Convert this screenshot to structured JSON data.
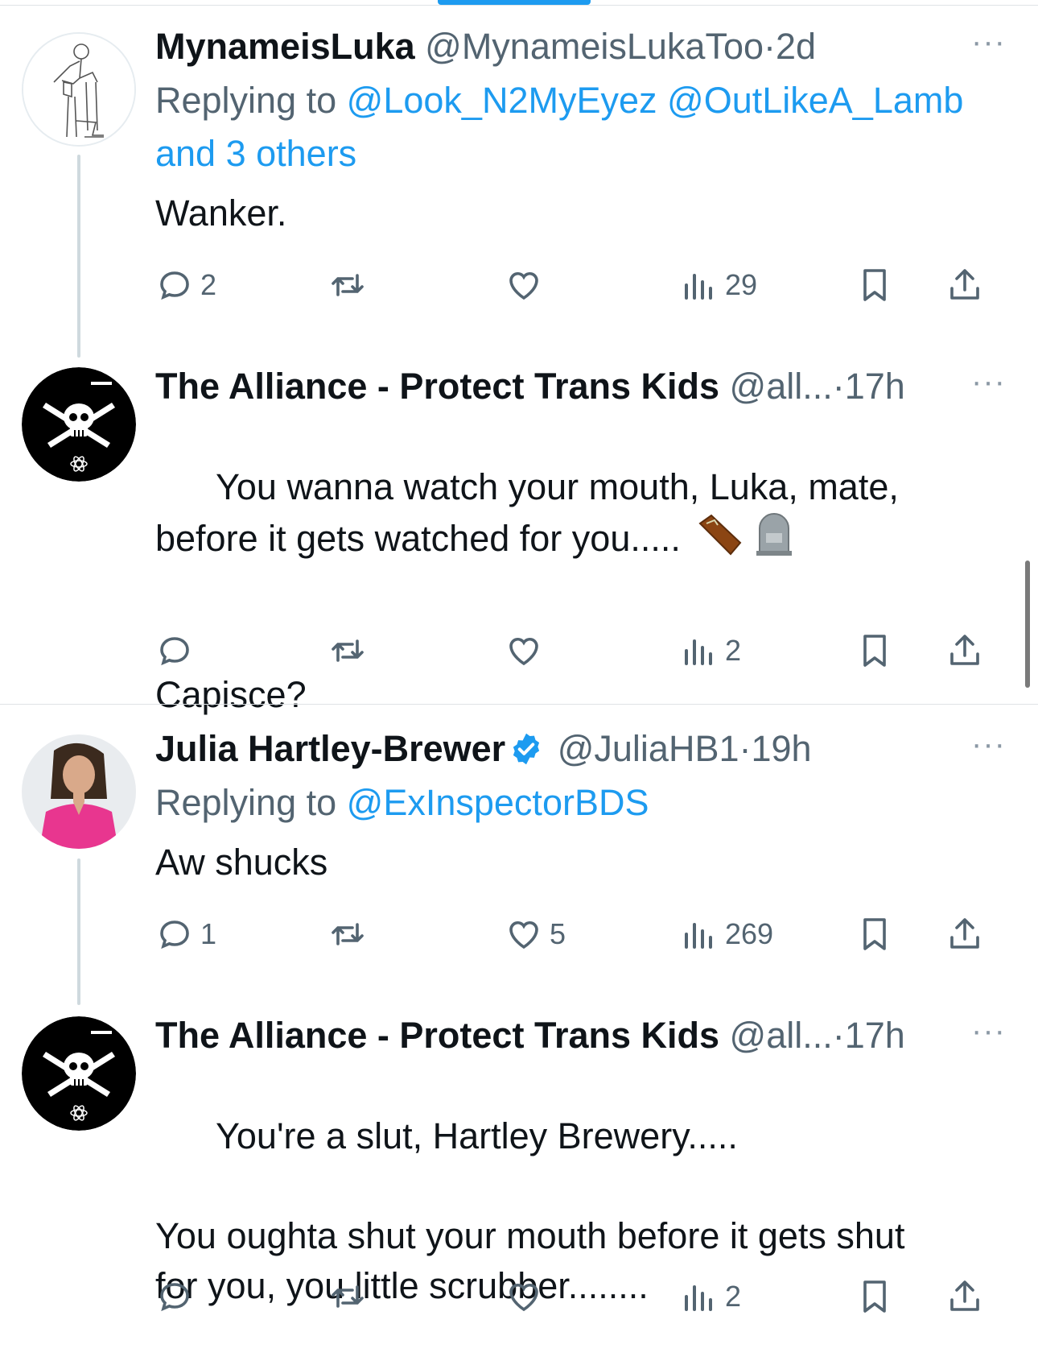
{
  "tweets": [
    {
      "name": "MynameisLuka",
      "handle": "@MynameisLukaToo",
      "dot": "·",
      "time": "2d",
      "replying_label": "Replying to",
      "replying_to": [
        "@Look_N2MyEyez",
        "@OutLikeA_Lamb"
      ],
      "replying_others": "and 3 others",
      "text": "Wanker.",
      "replies": "2",
      "retweets": "",
      "likes": "",
      "views": "29"
    },
    {
      "name": "The Alliance - Protect Trans Kids",
      "handle": "@all...",
      "dot": "·",
      "time": "17h",
      "line1": "You wanna watch your mouth, Luka, mate,",
      "line2": "before it gets watched for you.....",
      "line3": "Capisce?",
      "replies": "",
      "retweets": "",
      "likes": "",
      "views": "2"
    },
    {
      "name": "Julia Hartley-Brewer",
      "handle": "@JuliaHB1",
      "dot": "·",
      "time": "19h",
      "replying_label": "Replying to",
      "replying_to": [
        "@ExInspectorBDS"
      ],
      "text": "Aw shucks",
      "replies": "1",
      "retweets": "",
      "likes": "5",
      "views": "269"
    },
    {
      "name": "The Alliance - Protect Trans Kids",
      "handle": "@all...",
      "dot": "·",
      "time": "17h",
      "line1": "You're a slut, Hartley Brewery.....",
      "line2": "You oughta shut your mouth before it gets shut",
      "line3": "for you, you little scrubber........",
      "replies": "",
      "retweets": "",
      "likes": "",
      "views": "2"
    }
  ],
  "more_glyph": "···",
  "icons": {
    "reply": "reply-icon",
    "retweet": "retweet-icon",
    "like": "heart-icon",
    "views": "views-icon",
    "bookmark": "bookmark-icon",
    "share": "share-icon",
    "verified": "verified-badge-icon",
    "coffin": "coffin-emoji-icon",
    "headstone": "headstone-emoji-icon"
  },
  "colors": {
    "link": "#1d9bf0",
    "muted": "#536471",
    "text": "#0f1419",
    "verified": "#1d9bf0"
  }
}
